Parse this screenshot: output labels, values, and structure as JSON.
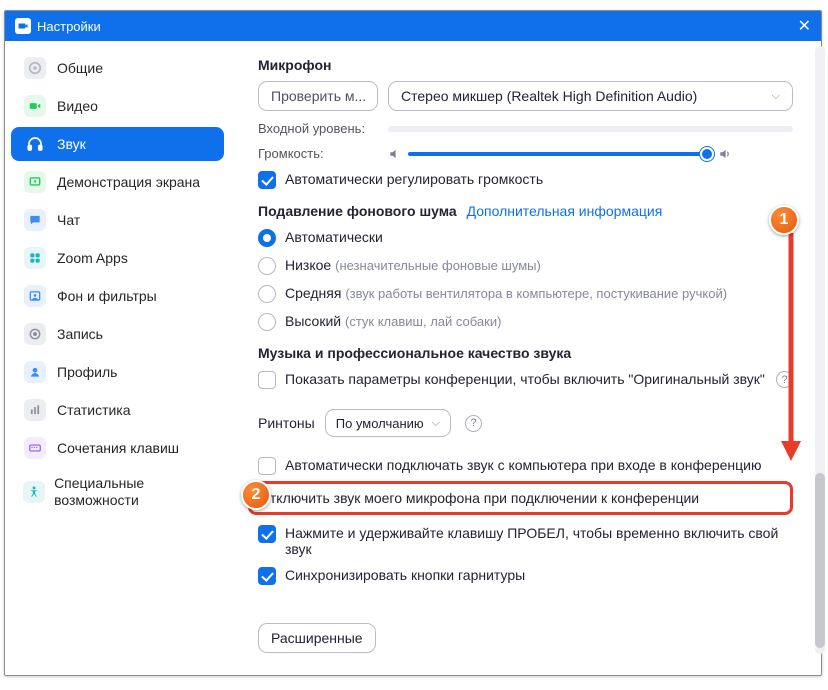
{
  "titlebar": {
    "title": "Настройки",
    "close": "✕"
  },
  "sidebar": {
    "items": [
      {
        "label": "Общие",
        "name": "sidebar-item-general"
      },
      {
        "label": "Видео",
        "name": "sidebar-item-video"
      },
      {
        "label": "Звук",
        "name": "sidebar-item-audio",
        "active": true
      },
      {
        "label": "Демонстрация экрана",
        "name": "sidebar-item-share"
      },
      {
        "label": "Чат",
        "name": "sidebar-item-chat"
      },
      {
        "label": "Zoom Apps",
        "name": "sidebar-item-zoomapps"
      },
      {
        "label": "Фон и фильтры",
        "name": "sidebar-item-background"
      },
      {
        "label": "Запись",
        "name": "sidebar-item-recording"
      },
      {
        "label": "Профиль",
        "name": "sidebar-item-profile"
      },
      {
        "label": "Статистика",
        "name": "sidebar-item-stats"
      },
      {
        "label": "Сочетания клавиш",
        "name": "sidebar-item-shortcuts"
      },
      {
        "label": "Специальные возможности",
        "name": "sidebar-item-accessibility"
      }
    ]
  },
  "main": {
    "mic_heading": "Микрофон",
    "test_btn": "Проверить м...",
    "mic_device": "Стерео микшер (Realtek High Definition Audio)",
    "input_level_label": "Входной уровень:",
    "volume_label": "Громкость:",
    "auto_adjust": "Автоматически регулировать громкость",
    "noise_heading": "Подавление фонового шума",
    "noise_link": "Дополнительная информация",
    "noise": {
      "auto": "Автоматически",
      "low": "Низкое",
      "low_hint": "(незначительные фоновые шумы)",
      "mid": "Средняя",
      "mid_hint": "(звук работы вентилятора в компьютере, постукивание ручкой)",
      "high": "Высокий",
      "high_hint": "(стук клавиш, лай собаки)"
    },
    "music_heading": "Музыка и профессиональное качество звука",
    "original_sound": "Показать параметры конференции, чтобы включить \"Оригинальный звук\"",
    "ringtones_label": "Ринтоны",
    "ringtones_value": "По умолчанию",
    "opts": {
      "auto_join_audio": "Автоматически подключать звук с компьютера при входе в конференцию",
      "mute_mic": "Отключить звук моего микрофона при подключении к конференции",
      "space_unmute": "Нажмите и удерживайте клавишу ПРОБЕЛ, чтобы временно включить свой звук",
      "sync_headset": "Синхронизировать кнопки гарнитуры"
    },
    "advanced_btn": "Расширенные"
  },
  "markers": {
    "m1": "1",
    "m2": "2"
  }
}
